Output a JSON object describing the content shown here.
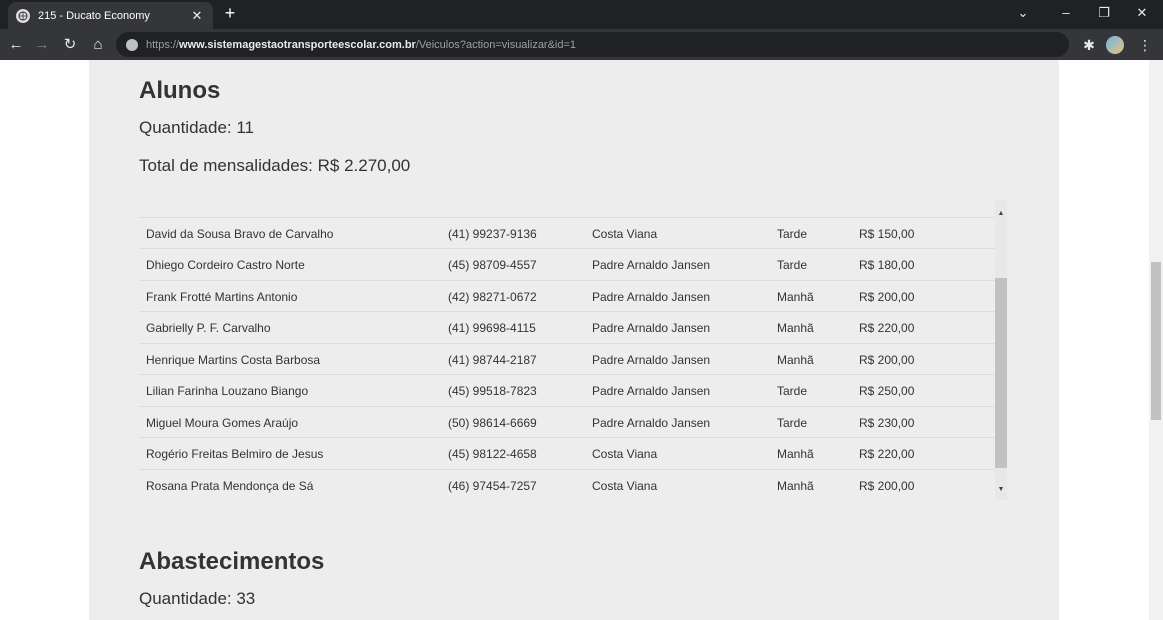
{
  "browser": {
    "tab_title": "215 - Ducato Economy",
    "tab_close": "✕",
    "new_tab": "+",
    "url_proto": "https://",
    "url_host": "www.sistemagestaotransporteescolar.com.br",
    "url_path": "/Veiculos?action=visualizar&id=1"
  },
  "alunos": {
    "heading": "Alunos",
    "quantidade": "Quantidade: 11",
    "total": "Total de mensalidades: R$ 2.270,00",
    "rows": [
      {
        "nome": "David da Sousa Bravo de Carvalho",
        "telefone": "(41) 99237-9136",
        "escola": "Costa Viana",
        "turno": "Tarde",
        "valor": "R$ 150,00"
      },
      {
        "nome": "Dhiego Cordeiro Castro Norte",
        "telefone": "(45) 98709-4557",
        "escola": "Padre Arnaldo Jansen",
        "turno": "Tarde",
        "valor": "R$ 180,00"
      },
      {
        "nome": "Frank Frotté Martins Antonio",
        "telefone": "(42) 98271-0672",
        "escola": "Padre Arnaldo Jansen",
        "turno": "Manhã",
        "valor": "R$ 200,00"
      },
      {
        "nome": "Gabrielly P. F. Carvalho",
        "telefone": "(41) 99698-4115",
        "escola": "Padre Arnaldo Jansen",
        "turno": "Manhã",
        "valor": "R$ 220,00"
      },
      {
        "nome": "Henrique Martins Costa Barbosa",
        "telefone": "(41) 98744-2187",
        "escola": "Padre Arnaldo Jansen",
        "turno": "Manhã",
        "valor": "R$ 200,00"
      },
      {
        "nome": "Lilian Farinha Louzano Biango",
        "telefone": "(45) 99518-7823",
        "escola": "Padre Arnaldo Jansen",
        "turno": "Tarde",
        "valor": "R$ 250,00"
      },
      {
        "nome": "Miguel Moura Gomes Araújo",
        "telefone": "(50) 98614-6669",
        "escola": "Padre Arnaldo Jansen",
        "turno": "Tarde",
        "valor": "R$ 230,00"
      },
      {
        "nome": "Rogério Freitas Belmiro de Jesus",
        "telefone": "(45) 98122-4658",
        "escola": "Costa Viana",
        "turno": "Manhã",
        "valor": "R$ 220,00"
      },
      {
        "nome": "Rosana Prata Mendonça de Sá",
        "telefone": "(46) 97454-7257",
        "escola": "Costa Viana",
        "turno": "Manhã",
        "valor": "R$ 200,00"
      }
    ]
  },
  "abastecimentos": {
    "heading": "Abastecimentos",
    "quantidade": "Quantidade: 33"
  },
  "colors": {
    "content_bg": "#ededed",
    "chrome_dark": "#202124",
    "chrome_toolbar": "#35363a"
  }
}
